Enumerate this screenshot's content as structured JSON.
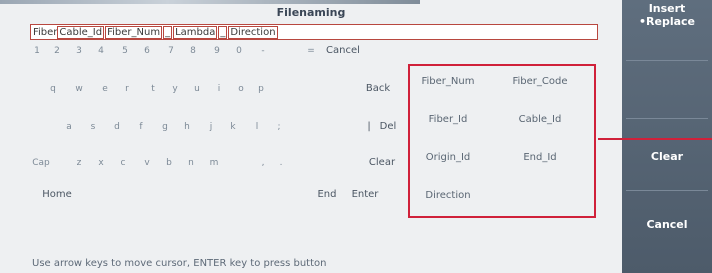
{
  "dialog": {
    "title": "Filenaming",
    "filename_tokens": [
      "Fiber",
      "Cable_Id",
      "Fiber_Num",
      "_",
      "Lambda",
      "_",
      "Direction"
    ],
    "hint": "Use arrow keys to move cursor, ENTER key to press button"
  },
  "keyboard": {
    "row1": [
      "1",
      "2",
      "3",
      "4",
      "5",
      "6",
      "7",
      "8",
      "9",
      "0",
      "-",
      "="
    ],
    "row2": [
      "q",
      "w",
      "e",
      "r",
      "t",
      "y",
      "u",
      "i",
      "o",
      "p"
    ],
    "row3": [
      "a",
      "s",
      "d",
      "f",
      "g",
      "h",
      "j",
      "k",
      "l",
      ";"
    ],
    "row4": [
      "z",
      "x",
      "c",
      "v",
      "b",
      "n",
      "m",
      ",",
      "."
    ],
    "cancel": "Cancel",
    "back": "Back",
    "del": "Del",
    "del_pipe": "|",
    "clear": "Clear",
    "caps": "Cap",
    "home": "Home",
    "end": "End",
    "enter": "Enter"
  },
  "field_buttons": [
    [
      "Fiber_Num",
      "Fiber_Code"
    ],
    [
      "Fiber_Id",
      "Cable_Id"
    ],
    [
      "Origin_Id",
      "End_Id"
    ],
    [
      "Direction",
      ""
    ]
  ],
  "side_panel": {
    "insert_label": "Insert",
    "replace_label": "•Replace",
    "clear_label": "Clear",
    "cancel_label": "Cancel"
  },
  "colors": {
    "highlight": "#d0213a",
    "side_panel": "#56636f"
  }
}
